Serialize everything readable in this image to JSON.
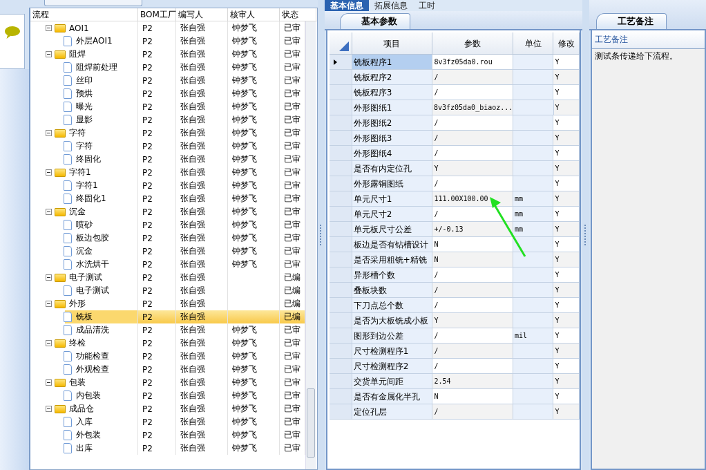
{
  "process_tree": {
    "columns": [
      "流程",
      "BOM工厂",
      "编写人",
      "核审人",
      "状态"
    ],
    "rows": [
      {
        "kind": "folder",
        "label": "AOI1",
        "bom_factory": "P2",
        "writer": "张自强",
        "reviewer": "钟梦飞",
        "status": "已审",
        "expanded": true,
        "selected": false,
        "children": [
          {
            "kind": "file",
            "label": "外层AOI1",
            "bom_factory": "P2",
            "writer": "张自强",
            "reviewer": "钟梦飞",
            "status": "已审",
            "selected": false
          }
        ]
      },
      {
        "kind": "folder",
        "label": "阻焊",
        "bom_factory": "P2",
        "writer": "张自强",
        "reviewer": "钟梦飞",
        "status": "已审",
        "expanded": true,
        "selected": false,
        "children": [
          {
            "kind": "file",
            "label": "阻焊前处理",
            "bom_factory": "P2",
            "writer": "张自强",
            "reviewer": "钟梦飞",
            "status": "已审",
            "selected": false
          },
          {
            "kind": "file",
            "label": "丝印",
            "bom_factory": "P2",
            "writer": "张自强",
            "reviewer": "钟梦飞",
            "status": "已审",
            "selected": false
          },
          {
            "kind": "file",
            "label": "预烘",
            "bom_factory": "P2",
            "writer": "张自强",
            "reviewer": "钟梦飞",
            "status": "已审",
            "selected": false
          },
          {
            "kind": "file",
            "label": "曝光",
            "bom_factory": "P2",
            "writer": "张自强",
            "reviewer": "钟梦飞",
            "status": "已审",
            "selected": false
          },
          {
            "kind": "file",
            "label": "显影",
            "bom_factory": "P2",
            "writer": "张自强",
            "reviewer": "钟梦飞",
            "status": "已审",
            "selected": false
          }
        ]
      },
      {
        "kind": "folder",
        "label": "字符",
        "bom_factory": "P2",
        "writer": "张自强",
        "reviewer": "钟梦飞",
        "status": "已审",
        "expanded": true,
        "selected": false,
        "children": [
          {
            "kind": "file",
            "label": "字符",
            "bom_factory": "P2",
            "writer": "张自强",
            "reviewer": "钟梦飞",
            "status": "已审",
            "selected": false
          },
          {
            "kind": "file",
            "label": "终固化",
            "bom_factory": "P2",
            "writer": "张自强",
            "reviewer": "钟梦飞",
            "status": "已审",
            "selected": false
          }
        ]
      },
      {
        "kind": "folder",
        "label": "字符1",
        "bom_factory": "P2",
        "writer": "张自强",
        "reviewer": "钟梦飞",
        "status": "已审",
        "expanded": true,
        "selected": false,
        "children": [
          {
            "kind": "file",
            "label": "字符1",
            "bom_factory": "P2",
            "writer": "张自强",
            "reviewer": "钟梦飞",
            "status": "已审",
            "selected": false
          },
          {
            "kind": "file",
            "label": "终固化1",
            "bom_factory": "P2",
            "writer": "张自强",
            "reviewer": "钟梦飞",
            "status": "已审",
            "selected": false
          }
        ]
      },
      {
        "kind": "folder",
        "label": "沉金",
        "bom_factory": "P2",
        "writer": "张自强",
        "reviewer": "钟梦飞",
        "status": "已审",
        "expanded": true,
        "selected": false,
        "children": [
          {
            "kind": "file",
            "label": "喷砂",
            "bom_factory": "P2",
            "writer": "张自强",
            "reviewer": "钟梦飞",
            "status": "已审",
            "selected": false
          },
          {
            "kind": "file",
            "label": "板边包胶",
            "bom_factory": "P2",
            "writer": "张自强",
            "reviewer": "钟梦飞",
            "status": "已审",
            "selected": false
          },
          {
            "kind": "file",
            "label": "沉金",
            "bom_factory": "P2",
            "writer": "张自强",
            "reviewer": "钟梦飞",
            "status": "已审",
            "selected": false
          },
          {
            "kind": "file",
            "label": "水洗烘干",
            "bom_factory": "P2",
            "writer": "张自强",
            "reviewer": "钟梦飞",
            "status": "已审",
            "selected": false
          }
        ]
      },
      {
        "kind": "folder",
        "label": "电子测试",
        "bom_factory": "P2",
        "writer": "张自强",
        "status": "已编",
        "expanded": true,
        "selected": false,
        "children": [
          {
            "kind": "file",
            "label": "电子测试",
            "bom_factory": "P2",
            "writer": "张自强",
            "status": "已编",
            "selected": false
          }
        ]
      },
      {
        "kind": "folder",
        "label": "外形",
        "bom_factory": "P2",
        "writer": "张自强",
        "status": "已编",
        "expanded": true,
        "selected": false,
        "children": [
          {
            "kind": "file",
            "label": "铣板",
            "bom_factory": "P2",
            "writer": "张自强",
            "status": "已编",
            "selected": true
          },
          {
            "kind": "file",
            "label": "成品清洗",
            "bom_factory": "P2",
            "writer": "张自强",
            "reviewer": "钟梦飞",
            "status": "已审",
            "selected": false
          }
        ]
      },
      {
        "kind": "folder",
        "label": "终检",
        "bom_factory": "P2",
        "writer": "张自强",
        "reviewer": "钟梦飞",
        "status": "已审",
        "expanded": true,
        "selected": false,
        "children": [
          {
            "kind": "file",
            "label": "功能检查",
            "bom_factory": "P2",
            "writer": "张自强",
            "reviewer": "钟梦飞",
            "status": "已审",
            "selected": false
          },
          {
            "kind": "file",
            "label": "外观检查",
            "bom_factory": "P2",
            "writer": "张自强",
            "reviewer": "钟梦飞",
            "status": "已审",
            "selected": false
          }
        ]
      },
      {
        "kind": "folder",
        "label": "包装",
        "bom_factory": "P2",
        "writer": "张自强",
        "reviewer": "钟梦飞",
        "status": "已审",
        "expanded": true,
        "selected": false,
        "children": [
          {
            "kind": "file",
            "label": "内包装",
            "bom_factory": "P2",
            "writer": "张自强",
            "reviewer": "钟梦飞",
            "status": "已审",
            "selected": false
          }
        ]
      },
      {
        "kind": "folder",
        "label": "成品仓",
        "bom_factory": "P2",
        "writer": "张自强",
        "reviewer": "钟梦飞",
        "status": "已审",
        "expanded": true,
        "selected": false,
        "children": [
          {
            "kind": "file",
            "label": "入库",
            "bom_factory": "P2",
            "writer": "张自强",
            "reviewer": "钟梦飞",
            "status": "已审",
            "selected": false
          },
          {
            "kind": "file",
            "label": "外包装",
            "bom_factory": "P2",
            "writer": "张自强",
            "reviewer": "钟梦飞",
            "status": "已审",
            "selected": false
          },
          {
            "kind": "file",
            "label": "出库",
            "bom_factory": "P2",
            "writer": "张自强",
            "reviewer": "钟梦飞",
            "status": "已审",
            "selected": false
          }
        ]
      }
    ]
  },
  "detail_tabs": [
    {
      "label": "基本信息",
      "selected": true
    },
    {
      "label": "拓展信息",
      "selected": false
    },
    {
      "label": "工时",
      "selected": false
    }
  ],
  "params_panel": {
    "tab": "基本参数",
    "columns": [
      "项目",
      "参数",
      "单位",
      "修改"
    ],
    "rows": [
      {
        "item": "铣板程序1",
        "value": "8v3fz05da0.rou",
        "modified": "Y",
        "selected": true
      },
      {
        "item": "铣板程序2",
        "value": "/",
        "modified": "Y",
        "selected": false
      },
      {
        "item": "铣板程序3",
        "value": "/",
        "modified": "Y",
        "selected": false
      },
      {
        "item": "外形图纸1",
        "value": "8v3fz05da0_biaoz...",
        "modified": "Y",
        "selected": false
      },
      {
        "item": "外形图纸2",
        "value": "/",
        "modified": "Y",
        "selected": false
      },
      {
        "item": "外形图纸3",
        "value": "/",
        "modified": "Y",
        "selected": false
      },
      {
        "item": "外形图纸4",
        "value": "/",
        "modified": "Y",
        "selected": false
      },
      {
        "item": "是否有内定位孔",
        "value": "Y",
        "modified": "Y",
        "selected": false
      },
      {
        "item": "外形露铜图纸",
        "value": "/",
        "modified": "Y",
        "selected": false
      },
      {
        "item": "单元尺寸1",
        "value": "111.00X100.00",
        "unit": "mm",
        "modified": "Y",
        "selected": false
      },
      {
        "item": "单元尺寸2",
        "value": "/",
        "unit": "mm",
        "modified": "Y",
        "selected": false
      },
      {
        "item": "单元板尺寸公差",
        "value": "+/-0.13",
        "unit": "mm",
        "modified": "Y",
        "selected": false
      },
      {
        "item": "板边是否有钻槽设计",
        "value": "N",
        "modified": "Y",
        "selected": false
      },
      {
        "item": "是否采用粗铣+精铣",
        "value": "N",
        "modified": "Y",
        "selected": false
      },
      {
        "item": "异形槽个数",
        "value": "/",
        "modified": "Y",
        "selected": false
      },
      {
        "item": "叠板块数",
        "value": "/",
        "modified": "Y",
        "selected": false
      },
      {
        "item": "下刀点总个数",
        "value": "/",
        "modified": "Y",
        "selected": false
      },
      {
        "item": "是否为大板铣成小板",
        "value": "Y",
        "modified": "Y",
        "selected": false
      },
      {
        "item": "图形到边公差",
        "value": "/",
        "unit": "mil",
        "modified": "Y",
        "selected": false
      },
      {
        "item": "尺寸检测程序1",
        "value": "/",
        "modified": "Y",
        "selected": false
      },
      {
        "item": "尺寸检测程序2",
        "value": "/",
        "modified": "Y",
        "selected": false
      },
      {
        "item": "交货单元间距",
        "value": "2.54",
        "modified": "Y",
        "selected": false
      },
      {
        "item": "是否有金属化半孔",
        "value": "N",
        "modified": "Y",
        "selected": false
      },
      {
        "item": "定位孔层",
        "value": "/",
        "modified": "Y",
        "selected": false
      }
    ]
  },
  "notes_panel": {
    "tab": "工艺备注",
    "header": "工艺备注",
    "text": "测试条传递给下流程。"
  }
}
